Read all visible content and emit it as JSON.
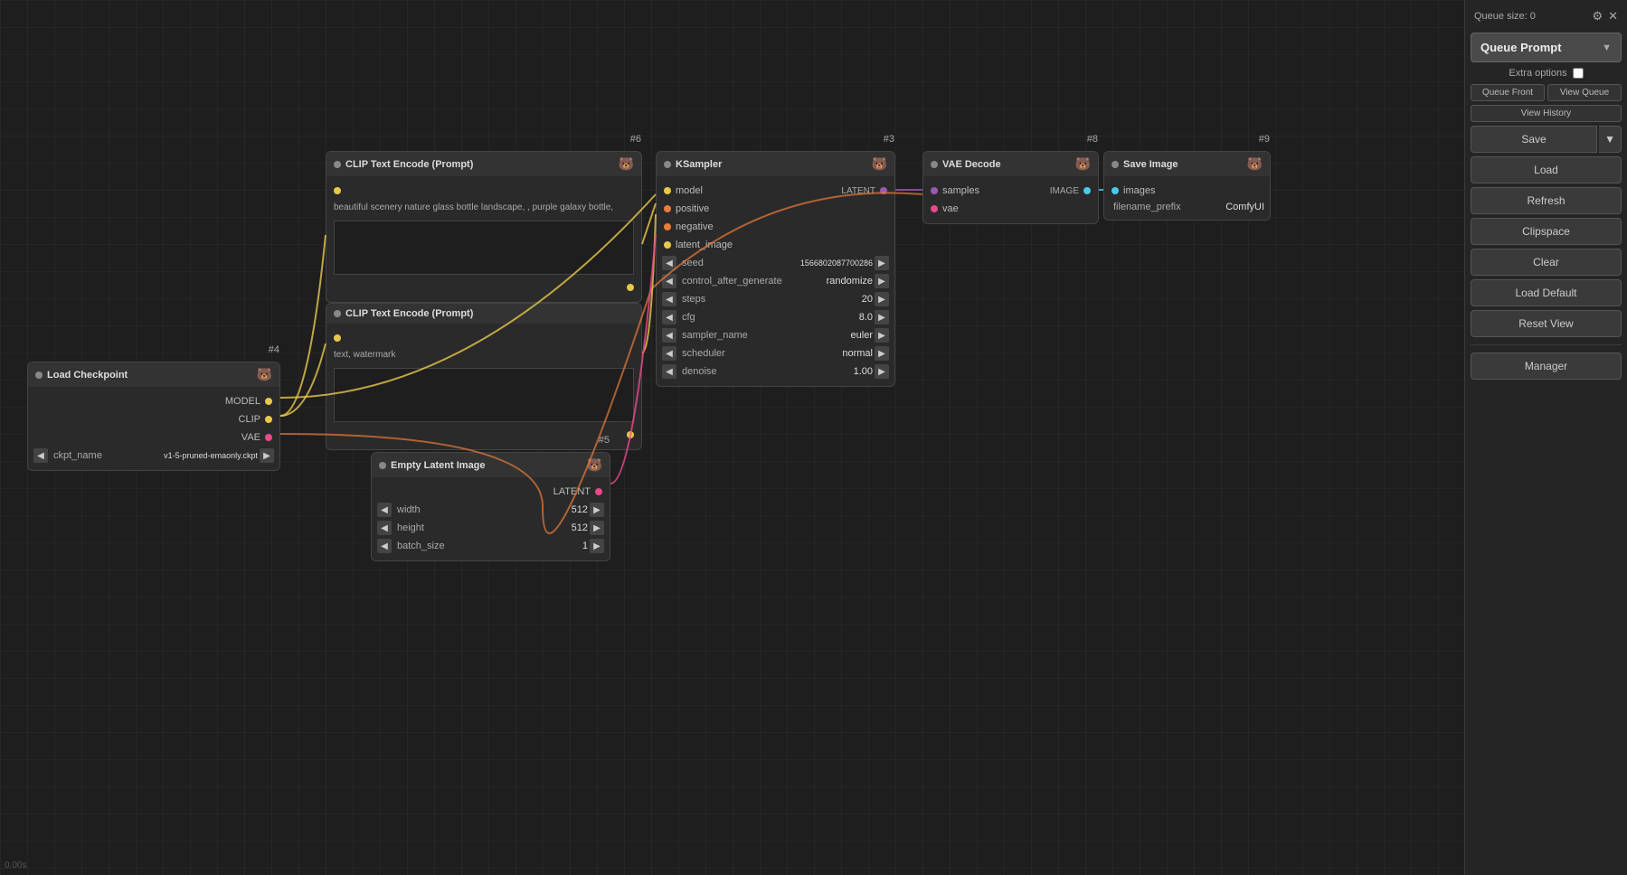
{
  "canvas": {
    "background": "#1e1e1e",
    "timestamp": "0.00s"
  },
  "right_panel": {
    "queue_size_label": "Queue size: 0",
    "queue_prompt_label": "Queue Prompt",
    "extra_options_label": "Extra options",
    "queue_front_label": "Queue Front",
    "view_queue_label": "View Queue",
    "view_history_label": "View History",
    "save_label": "Save",
    "load_label": "Load",
    "refresh_label": "Refresh",
    "clipspace_label": "Clipspace",
    "clear_label": "Clear",
    "load_default_label": "Load Default",
    "reset_view_label": "Reset View",
    "manager_label": "Manager"
  },
  "nodes": {
    "load_checkpoint": {
      "id": "#4",
      "title": "Load Checkpoint",
      "outputs": [
        "MODEL",
        "CLIP",
        "VAE"
      ],
      "ckpt_name_value": "v1-5-pruned-emaonly.ckpt"
    },
    "clip_text1": {
      "id": "#6",
      "title": "CLIP Text Encode (Prompt)",
      "text": "beautiful scenery nature glass bottle landscape, , purple galaxy bottle,"
    },
    "clip_text2": {
      "id": "",
      "title": "CLIP Text Encode (Prompt)",
      "text": "text, watermark"
    },
    "ksampler": {
      "id": "#3",
      "title": "KSampler",
      "inputs": [
        "model",
        "positive",
        "negative",
        "latent_image"
      ],
      "seed": "1566802087700286",
      "control_after_generate": "randomize",
      "steps": "20",
      "cfg": "8.0",
      "sampler_name": "euler",
      "scheduler": "normal",
      "denoise": "1.00"
    },
    "vae_decode": {
      "id": "#8",
      "title": "VAE Decode",
      "inputs": [
        "samples",
        "vae"
      ],
      "output": "IMAGE"
    },
    "save_image": {
      "id": "#9",
      "title": "Save Image",
      "inputs": [
        "images"
      ],
      "filename_prefix": "ComfyUI"
    },
    "empty_latent": {
      "id": "#5",
      "title": "Empty Latent Image",
      "output": "LATENT",
      "width": "512",
      "height": "512",
      "batch_size": "1"
    }
  }
}
